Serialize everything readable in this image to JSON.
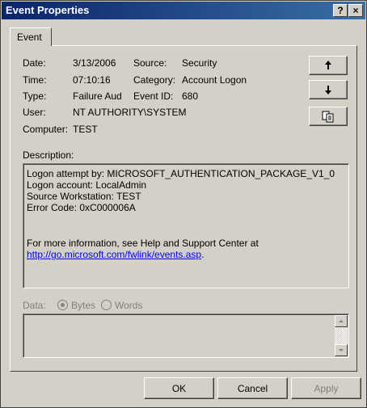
{
  "window": {
    "title": "Event Properties",
    "help_glyph": "?",
    "close_glyph": "×"
  },
  "tab": {
    "label": "Event"
  },
  "fields": {
    "date_label": "Date:",
    "date_value": "3/13/2006",
    "time_label": "Time:",
    "time_value": "07:10:16",
    "type_label": "Type:",
    "type_value": "Failure Aud",
    "user_label": "User:",
    "user_value": "NT AUTHORITY\\SYSTEM",
    "computer_label": "Computer:",
    "computer_value": "TEST",
    "source_label": "Source:",
    "source_value": "Security",
    "category_label": "Category:",
    "category_value": "Account Logon",
    "eventid_label": "Event ID:",
    "eventid_value": "680"
  },
  "nav_buttons": {
    "up_icon": "arrow-up-icon",
    "down_icon": "arrow-down-icon",
    "copy_icon": "copy-icon"
  },
  "description": {
    "label": "Description:",
    "lines": [
      "Logon attempt by: MICROSOFT_AUTHENTICATION_PACKAGE_V1_0",
      "Logon account:  LocalAdmin",
      "Source Workstation: TEST",
      "Error Code: 0xC000006A"
    ],
    "more_info": "For more information, see Help and Support Center at",
    "link": "http://go.microsoft.com/fwlink/events.asp",
    "link_suffix": "."
  },
  "data": {
    "label": "Data:",
    "bytes_label": "Bytes",
    "words_label": "Words",
    "selected": "Bytes"
  },
  "buttons": {
    "ok": "OK",
    "cancel": "Cancel",
    "apply": "Apply"
  },
  "colors": {
    "titlebar": "#0a246a",
    "face": "#d4d0c8",
    "link": "#0000ff"
  }
}
